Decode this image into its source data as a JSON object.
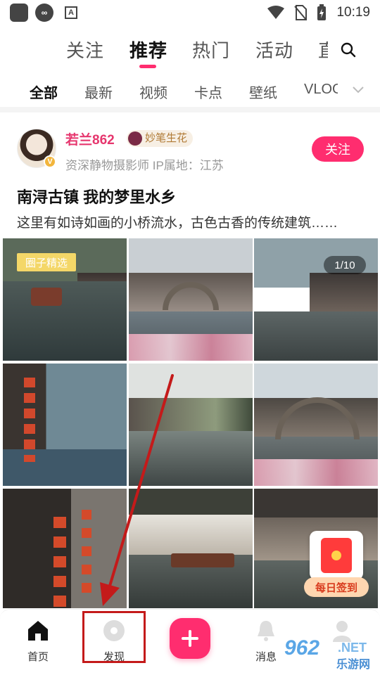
{
  "status_bar": {
    "time": "10:19",
    "app_icon_a": "A"
  },
  "top_tabs": [
    {
      "label": "关注"
    },
    {
      "label": "推荐"
    },
    {
      "label": "热门"
    },
    {
      "label": "活动"
    },
    {
      "label": "直"
    }
  ],
  "sub_tabs": [
    {
      "label": "全部"
    },
    {
      "label": "最新"
    },
    {
      "label": "视频"
    },
    {
      "label": "卡点"
    },
    {
      "label": "壁纸"
    },
    {
      "label": "VLOG"
    }
  ],
  "post": {
    "author_name": "若兰862",
    "author_tag": "妙笔生花",
    "author_badge": "V",
    "author_info": "资深静物摄影师   IP属地：江苏",
    "follow_label": "关注",
    "title": "南浔古镇 我的梦里水乡",
    "description": "这里有如诗如画的小桥流水，古色古香的传统建筑……",
    "image_badge": "圈子精选",
    "image_counter": "1/10"
  },
  "checkin": {
    "label": "每日签到"
  },
  "bottom_nav": {
    "home": "首页",
    "discover": "发现",
    "messages": "消息"
  },
  "watermark": {
    "number": "962",
    "suffix": ".NET",
    "site": "乐游网"
  },
  "colors": {
    "accent": "#ff2d6f",
    "annotation": "#c41a1a"
  }
}
